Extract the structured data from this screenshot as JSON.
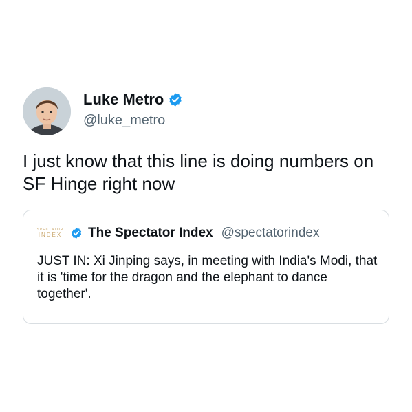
{
  "tweet": {
    "author": {
      "display_name": "Luke Metro",
      "handle": "@luke_metro",
      "verified": true
    },
    "text": "I just know that this line is doing numbers on SF Hinge right now"
  },
  "quoted_tweet": {
    "logo": {
      "line1": "SPECTATOR",
      "line2": "INDEX"
    },
    "author": {
      "display_name": "The Spectator Index",
      "handle": "@spectatorindex",
      "verified": true
    },
    "text": "JUST IN: Xi Jinping says, in meeting with India's Modi, that it is 'time for the dragon and the elephant to dance together'."
  },
  "colors": {
    "verified_badge": "#1d9bf0",
    "secondary_text": "#536471",
    "border": "#d9dee2"
  }
}
